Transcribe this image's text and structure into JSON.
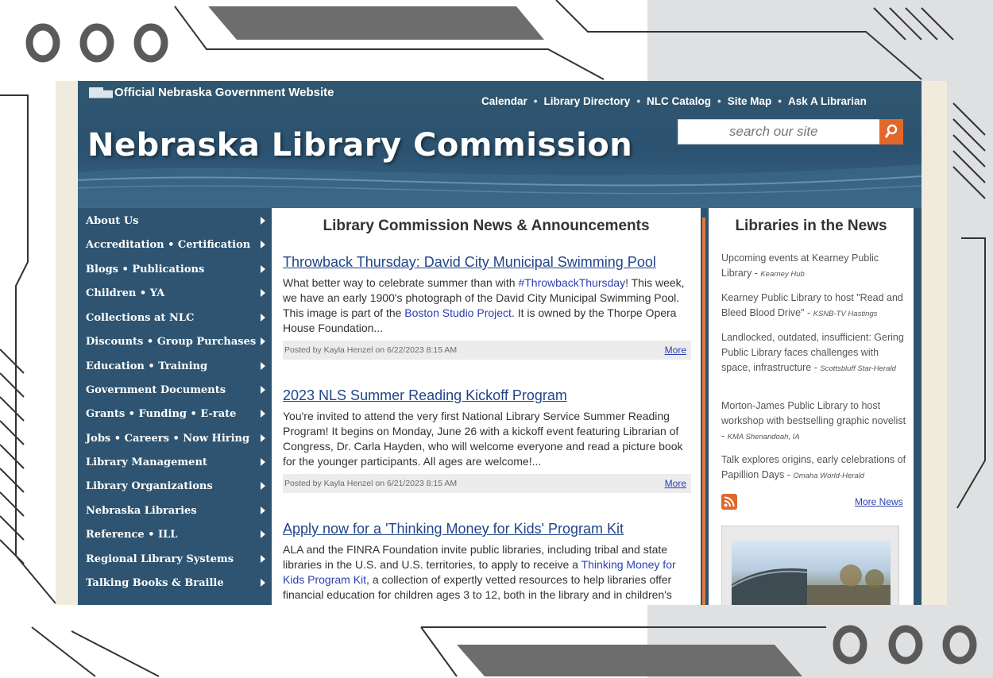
{
  "gov_banner": {
    "label": "Official Nebraska Government Website"
  },
  "top_nav": [
    "Calendar",
    "Library Directory",
    "NLC Catalog",
    "Site Map",
    "Ask A Librarian"
  ],
  "site_title": "Nebraska Library Commission",
  "search": {
    "placeholder": "search our site"
  },
  "left_nav": [
    "About Us",
    "Accreditation • Certification",
    "Blogs • Publications",
    "Children • YA",
    "Collections at NLC",
    "Discounts • Group Purchases",
    "Education • Training",
    "Government Documents",
    "Grants • Funding • E-rate",
    "Jobs • Careers • Now Hiring",
    "Library Management",
    "Library Organizations",
    "Nebraska Libraries",
    "Reference • ILL",
    "Regional Library Systems",
    "Talking Books & Braille"
  ],
  "main": {
    "heading": "Library Commission News & Announcements",
    "articles": [
      {
        "title": "Throwback Thursday: David City Municipal Swimming Pool",
        "body_before": "What better way to celebrate summer than with ",
        "link1": "#ThrowbackThursday",
        "body_mid": "! This week, we have an early 1900's photograph of the David City Municipal Swimming Pool. This image is part of the ",
        "link2": "Boston Studio Project",
        "body_after": ". It is owned by the Thorpe Opera House Foundation...",
        "posted": "Posted by Kayla Henzel on 6/22/2023 8:15 AM",
        "more": "More"
      },
      {
        "title": "2023 NLS Summer Reading Kickoff Program",
        "body": "You're invited to attend the very first National Library Service Summer Reading Program! It begins on Monday, June 26 with a kickoff event featuring Librarian of Congress, Dr. Carla Hayden, who will welcome everyone and read a picture book for the younger participants. All ages are welcome!...",
        "posted": "Posted by Kayla Henzel on 6/21/2023 8:15 AM",
        "more": "More"
      },
      {
        "title": "Apply now for a 'Thinking Money for Kids' Program Kit",
        "body_before": "ALA and the FINRA Foundation invite public libraries, including tribal and state libraries in the U.S. and U.S. territories, to apply to receive a ",
        "link1": "Thinking Money for Kids Program Kit",
        "body_after": ", a collection of expertly vetted resources to help libraries offer financial education for children ages 3 to 12, both in the library and in children's"
      }
    ]
  },
  "right": {
    "heading": "Libraries in the News",
    "items": [
      {
        "text": "Upcoming events at Kearney Public Library",
        "source": "Kearney Hub"
      },
      {
        "text": "Kearney Public Library to host \"Read and Bleed Blood Drive\"",
        "source": "KSNB-TV Hastings"
      },
      {
        "text": "Landlocked, outdated, insufficient: Gering Public Library faces challenges with space, infrastructure",
        "source": "Scottsbluff Star-Herald"
      },
      {
        "text": "Morton-James Public Library to host workshop with bestselling graphic novelist",
        "source": "KMA Shenandoah, IA"
      },
      {
        "text": "Talk explores origins, early celebrations of Papillion Days",
        "source": "Omaha World-Herald"
      }
    ],
    "more_news": "More News"
  },
  "colors": {
    "header_blue": "#2e5471",
    "accent_orange": "#e2672b",
    "link_blue": "#21468a"
  }
}
